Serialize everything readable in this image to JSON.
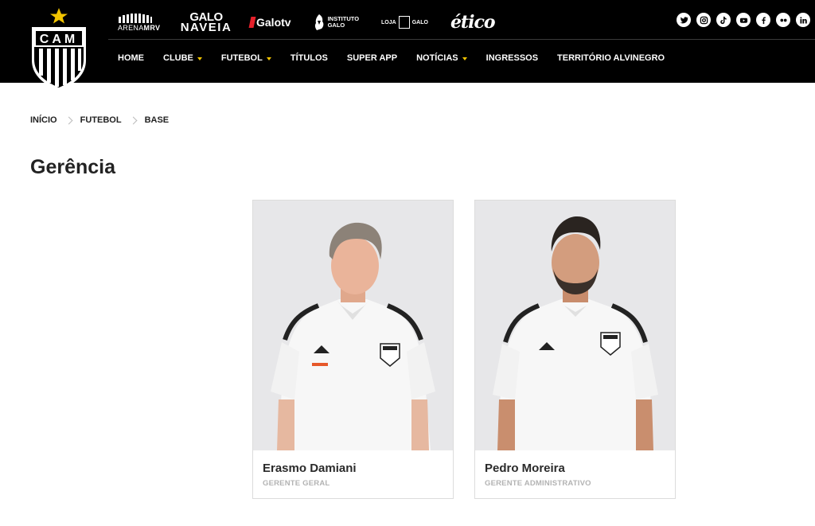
{
  "header": {
    "crest_text": "CAM",
    "partners": {
      "arena": "ARENA",
      "arena_bold": "MRV",
      "galonaveia_1": "GALO",
      "galonaveia_2": "NAVEIA",
      "galotv": "Galotv",
      "instituto_1": "INSTITUTO",
      "instituto_2": "GALO",
      "loja_1": "LOJA",
      "loja_2": "GALO",
      "etico": "ético"
    },
    "social": [
      "twitter-icon",
      "instagram-icon",
      "tiktok-icon",
      "youtube-icon",
      "facebook-icon",
      "flickr-icon",
      "linkedin-icon"
    ],
    "nav": [
      {
        "label": "HOME",
        "dropdown": false
      },
      {
        "label": "CLUBE",
        "dropdown": true
      },
      {
        "label": "FUTEBOL",
        "dropdown": true
      },
      {
        "label": "TÍTULOS",
        "dropdown": false
      },
      {
        "label": "SUPER APP",
        "dropdown": false
      },
      {
        "label": "NOTÍCIAS",
        "dropdown": true
      },
      {
        "label": "INGRESSOS",
        "dropdown": false
      },
      {
        "label": "TERRITÓRIO ALVINEGRO",
        "dropdown": false
      }
    ],
    "accent_color": "#f2c400"
  },
  "breadcrumb": [
    "INÍCIO",
    "FUTEBOL",
    "BASE"
  ],
  "page_title": "Gerência",
  "staff": [
    {
      "name": "Erasmo Damiani",
      "role": "GERENTE GERAL"
    },
    {
      "name": "Pedro Moreira",
      "role": "GERENTE ADMINISTRATIVO"
    }
  ]
}
